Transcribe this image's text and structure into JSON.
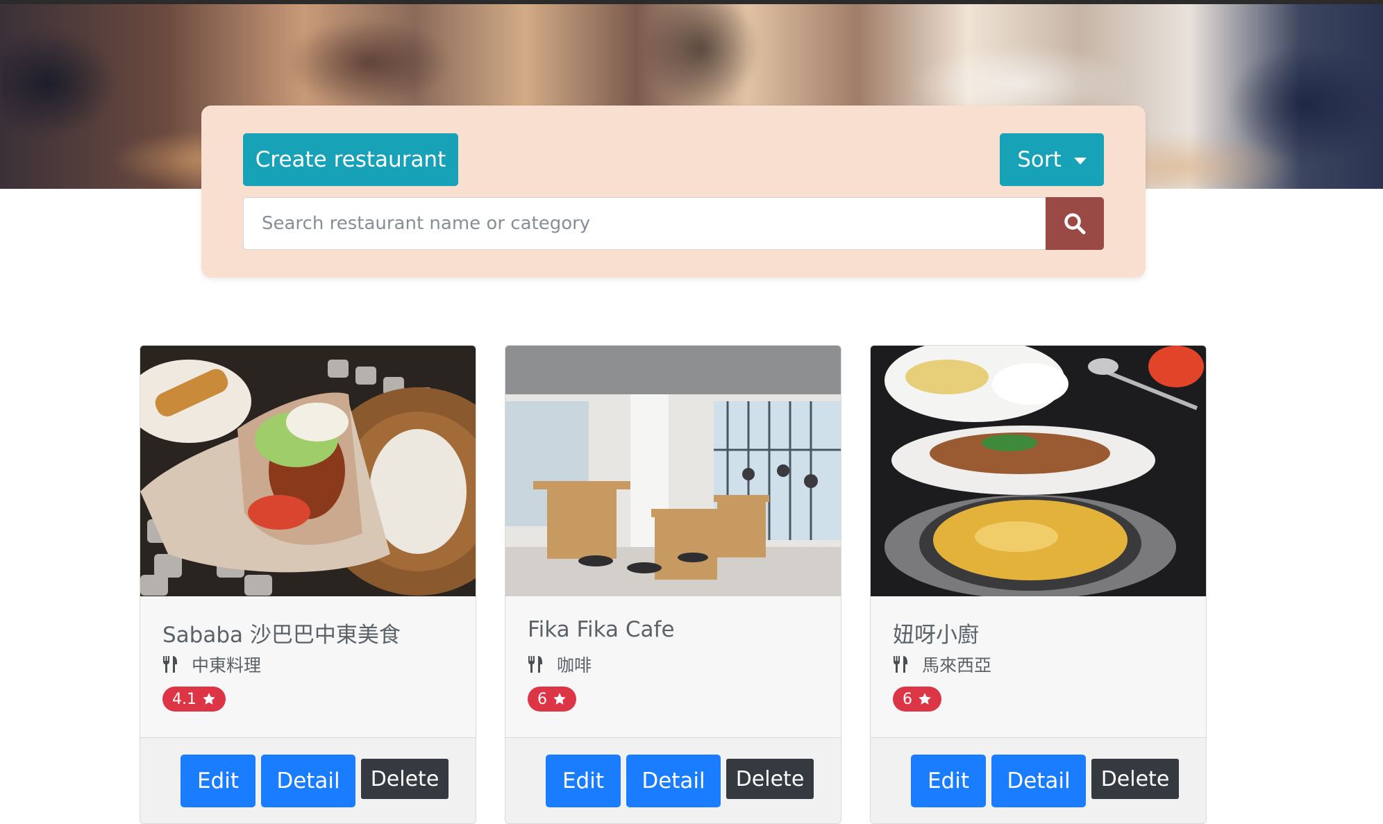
{
  "toolbar": {
    "create_label": "Create restaurant",
    "sort_label": "Sort"
  },
  "search": {
    "placeholder": "Search restaurant name or category"
  },
  "restaurants": [
    {
      "name": "Sababa 沙巴巴中東美食",
      "category": "中東料理",
      "rating": "4.1",
      "edit_label": "Edit",
      "detail_label": "Detail",
      "delete_label": "Delete"
    },
    {
      "name": "Fika Fika Cafe",
      "category": "咖啡",
      "rating": "6",
      "edit_label": "Edit",
      "detail_label": "Detail",
      "delete_label": "Delete"
    },
    {
      "name": "妞呀小廚",
      "category": "馬來西亞",
      "rating": "6",
      "edit_label": "Edit",
      "detail_label": "Detail",
      "delete_label": "Delete"
    }
  ],
  "colors": {
    "teal": "#17a2b8",
    "blue": "#1a7dff",
    "dark": "#343a40",
    "badge": "#dc3545",
    "search_button": "#9a4a45",
    "panel": "#f9dfd0"
  },
  "icons": {
    "search": "search-icon",
    "category": "utensils-icon",
    "rating": "star-icon",
    "sort": "caret-down-icon"
  }
}
